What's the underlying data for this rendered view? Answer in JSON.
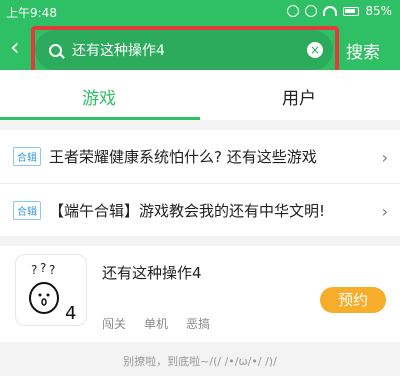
{
  "status_bar": {
    "time": "上午9:48",
    "battery": "85%"
  },
  "header": {
    "search_text": "还有这种操作4",
    "search_button": "搜索"
  },
  "tabs": [
    {
      "label": "游戏",
      "active": true
    },
    {
      "label": "用户",
      "active": false
    }
  ],
  "collections": [
    {
      "tag": "合辑",
      "title": "王者荣耀健康系统怕什么? 还有这些游戏"
    },
    {
      "tag": "合辑",
      "title": "【端午合辑】游戏教会我的还有中华文明!"
    }
  ],
  "game": {
    "title": "还有这种操作4",
    "tags": [
      "闯关",
      "单机",
      "恶搞"
    ],
    "action": "预约"
  },
  "footer": {
    "note": "别撩啦，到底啦~/(/ /•/ω/•/ /)/"
  },
  "colors": {
    "brand_green": "#2fbf64",
    "reserve_orange": "#f5ad2a",
    "highlight_red": "#e23b3b"
  }
}
